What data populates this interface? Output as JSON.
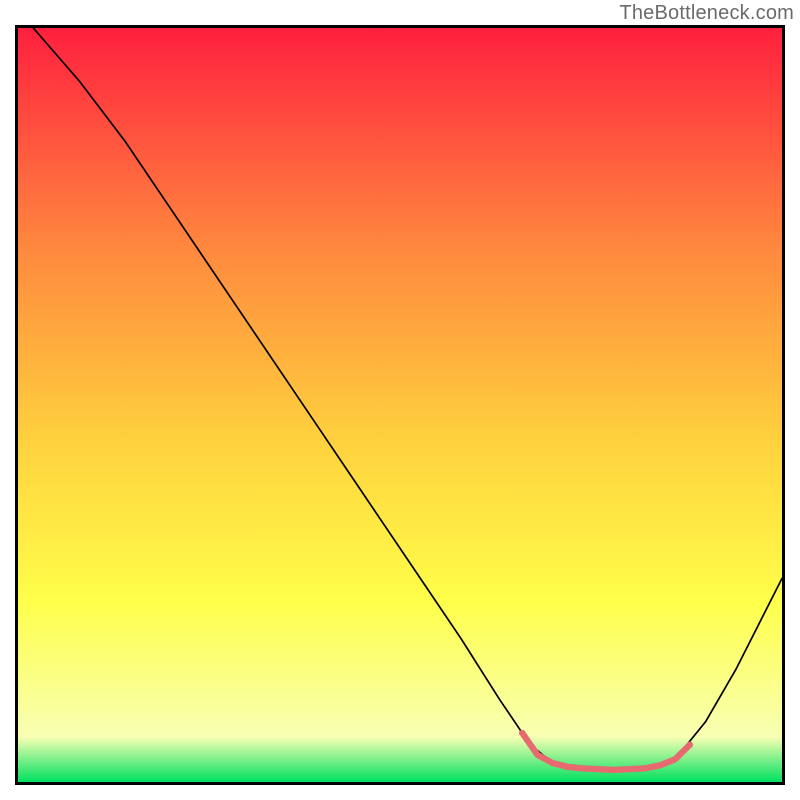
{
  "watermark": {
    "text": "TheBottleneck.com"
  },
  "chart_data": {
    "type": "line",
    "title": "",
    "xlabel": "",
    "ylabel": "",
    "xlim": [
      0,
      100
    ],
    "ylim": [
      0,
      100
    ],
    "background_gradient": {
      "top_color": "#ff203e",
      "mid_upper_color": "#ff8b3e",
      "mid_color": "#ffd23e",
      "mid_lower_color": "#ffff4a",
      "near_bottom_color": "#f8ffb3",
      "bottom_color": "#00e060"
    },
    "series": [
      {
        "name": "bottleneck-curve",
        "color": "#000000",
        "stroke_width": 1.7,
        "points": [
          {
            "x": 2,
            "y": 100
          },
          {
            "x": 8,
            "y": 93
          },
          {
            "x": 14,
            "y": 85
          },
          {
            "x": 20,
            "y": 76
          },
          {
            "x": 28,
            "y": 64
          },
          {
            "x": 36,
            "y": 52
          },
          {
            "x": 44,
            "y": 40
          },
          {
            "x": 52,
            "y": 28
          },
          {
            "x": 58,
            "y": 19
          },
          {
            "x": 63,
            "y": 11
          },
          {
            "x": 67,
            "y": 5
          },
          {
            "x": 70,
            "y": 2.5
          },
          {
            "x": 74,
            "y": 1.8
          },
          {
            "x": 78,
            "y": 1.6
          },
          {
            "x": 82,
            "y": 1.8
          },
          {
            "x": 86,
            "y": 3.0
          },
          {
            "x": 90,
            "y": 8
          },
          {
            "x": 94,
            "y": 15
          },
          {
            "x": 100,
            "y": 27
          }
        ]
      },
      {
        "name": "optimal-range-overlay",
        "color": "#e66a6f",
        "stroke_width": 6.5,
        "points": [
          {
            "x": 66,
            "y": 6.5
          },
          {
            "x": 68,
            "y": 3.6
          },
          {
            "x": 70,
            "y": 2.5
          },
          {
            "x": 72,
            "y": 2.0
          },
          {
            "x": 74,
            "y": 1.8
          },
          {
            "x": 76,
            "y": 1.7
          },
          {
            "x": 78,
            "y": 1.6
          },
          {
            "x": 80,
            "y": 1.7
          },
          {
            "x": 82,
            "y": 1.8
          },
          {
            "x": 84,
            "y": 2.2
          },
          {
            "x": 86,
            "y": 3.0
          },
          {
            "x": 88,
            "y": 5.0
          }
        ]
      }
    ]
  }
}
